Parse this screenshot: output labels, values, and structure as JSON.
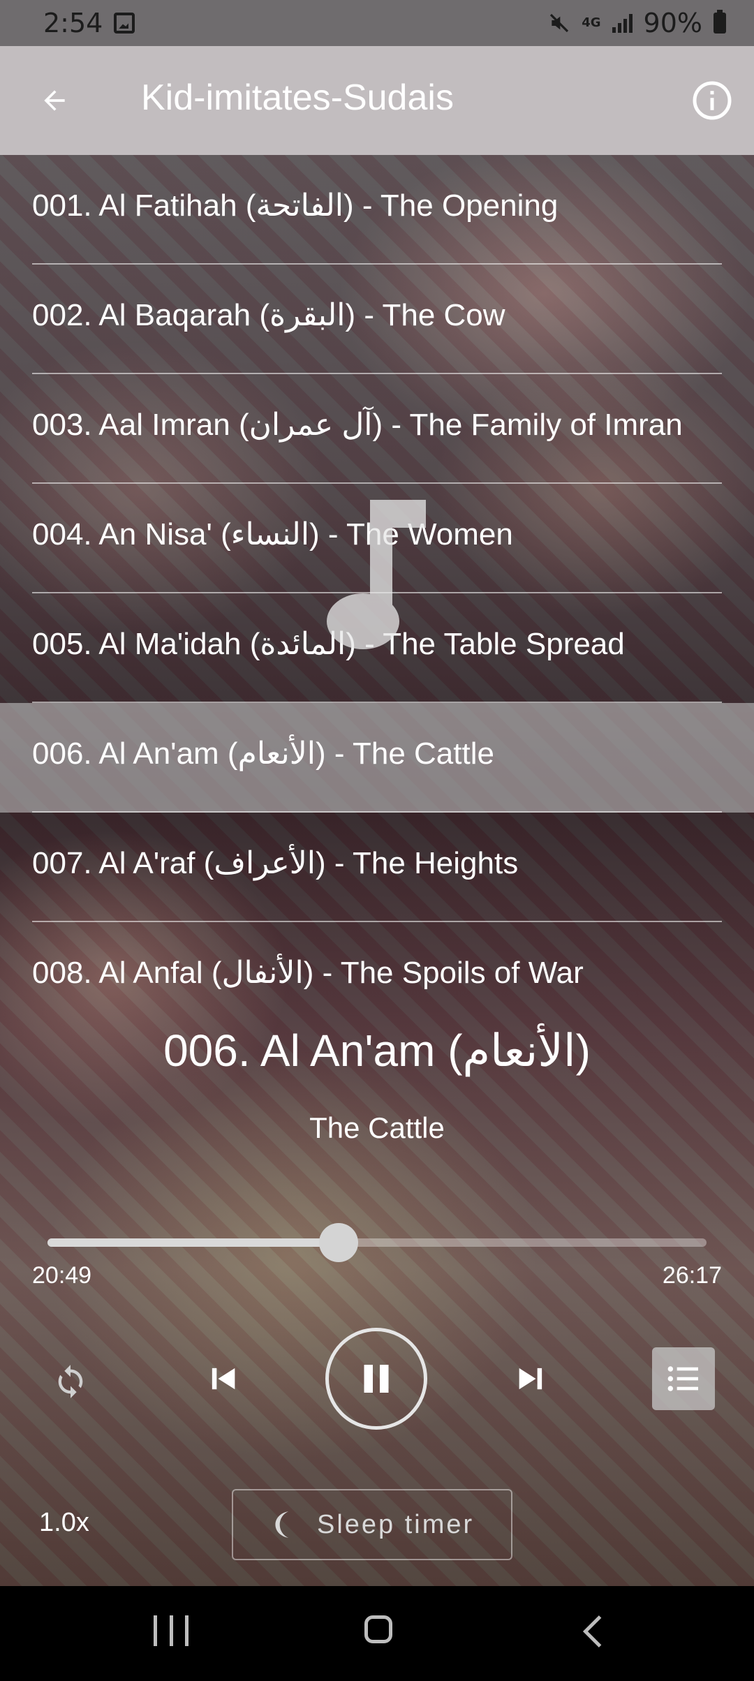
{
  "status_bar": {
    "time": "2:54",
    "network": "4G",
    "battery": "90%"
  },
  "app_bar": {
    "title": "Kid-imitates-Sudais"
  },
  "tracks": [
    {
      "label": "001. Al Fatihah (الفاتحة) - The Opening"
    },
    {
      "label": "002. Al Baqarah (البقرة) - The Cow"
    },
    {
      "label": "003. Aal Imran (آل عمران) - The Family of Imran"
    },
    {
      "label": "004. An Nisa' (النساء) - The Women"
    },
    {
      "label": "005. Al Ma'idah (المائدة) - The Table Spread"
    },
    {
      "label": "006. Al An'am (الأنعام) - The Cattle"
    },
    {
      "label": "007. Al A'raf (الأعراف) - The Heights"
    },
    {
      "label": "008. Al Anfal (الأنفال) - The Spoils of War"
    }
  ],
  "selected_track_index": 5,
  "now_playing": {
    "title": "006. Al An'am (الأنعام)",
    "subtitle": "The Cattle"
  },
  "progress": {
    "elapsed": "20:49",
    "total": "26:17",
    "fraction": 0.442
  },
  "controls": {
    "repeat_icon": "repeat-icon",
    "prev_icon": "skip-previous-icon",
    "play_state_icon": "pause-icon",
    "next_icon": "skip-next-icon",
    "playlist_icon": "playlist-icon"
  },
  "speed": "1.0x",
  "sleep_timer": {
    "label": "Sleep timer",
    "icon": "moon-icon"
  },
  "colors": {
    "app_bar": "#c2bdbf",
    "status_bar": "#6f6c6e",
    "selected_row": "#cdcdcd",
    "nav_bar": "#000000"
  }
}
